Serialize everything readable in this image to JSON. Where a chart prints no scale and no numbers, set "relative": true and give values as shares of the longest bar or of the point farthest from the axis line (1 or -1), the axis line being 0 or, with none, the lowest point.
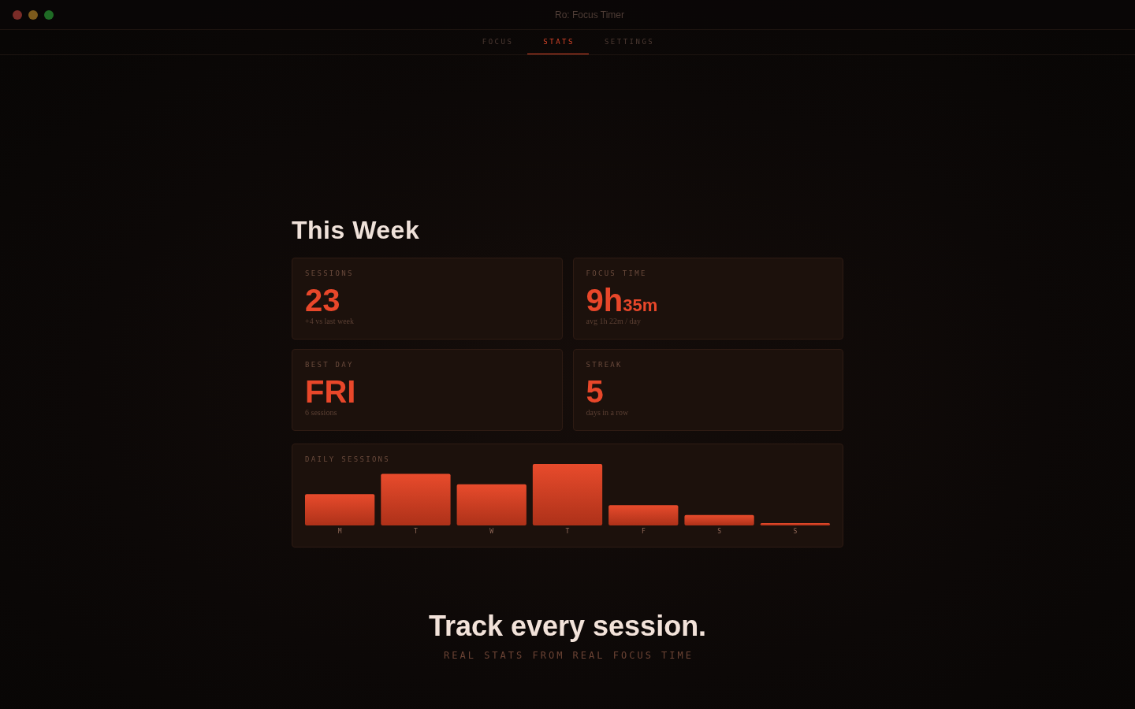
{
  "window": {
    "title": "Ro: Focus Timer"
  },
  "tabs": [
    {
      "label": "FOCUS",
      "selected": false
    },
    {
      "label": "STATS",
      "selected": true
    },
    {
      "label": "SETTINGS",
      "selected": false
    }
  ],
  "heading": "This Week",
  "stats": [
    {
      "label": "SESSIONS",
      "value": "23",
      "detail": "+4 vs last week"
    },
    {
      "label": "FOCUS TIME",
      "value": "9h",
      "value_minor": "35m",
      "detail": "avg 1h 22m / day"
    },
    {
      "label": "BEST DAY",
      "value": "FRI",
      "detail": "6 sessions"
    },
    {
      "label": "STREAK",
      "value": "5",
      "detail": "days in a row"
    }
  ],
  "daily_sessions": {
    "chart_data": {
      "type": "bar",
      "title": "DAILY SESSIONS",
      "categories": [
        "M",
        "T",
        "W",
        "T",
        "F",
        "S",
        "S"
      ],
      "values": [
        0.51,
        0.84,
        0.67,
        1,
        0.33,
        0.17,
        0.04
      ],
      "relative": true
    }
  },
  "tagline": {
    "title": "Track every session.",
    "subtitle": "REAL STATS FROM REAL FOCUS TIME"
  }
}
